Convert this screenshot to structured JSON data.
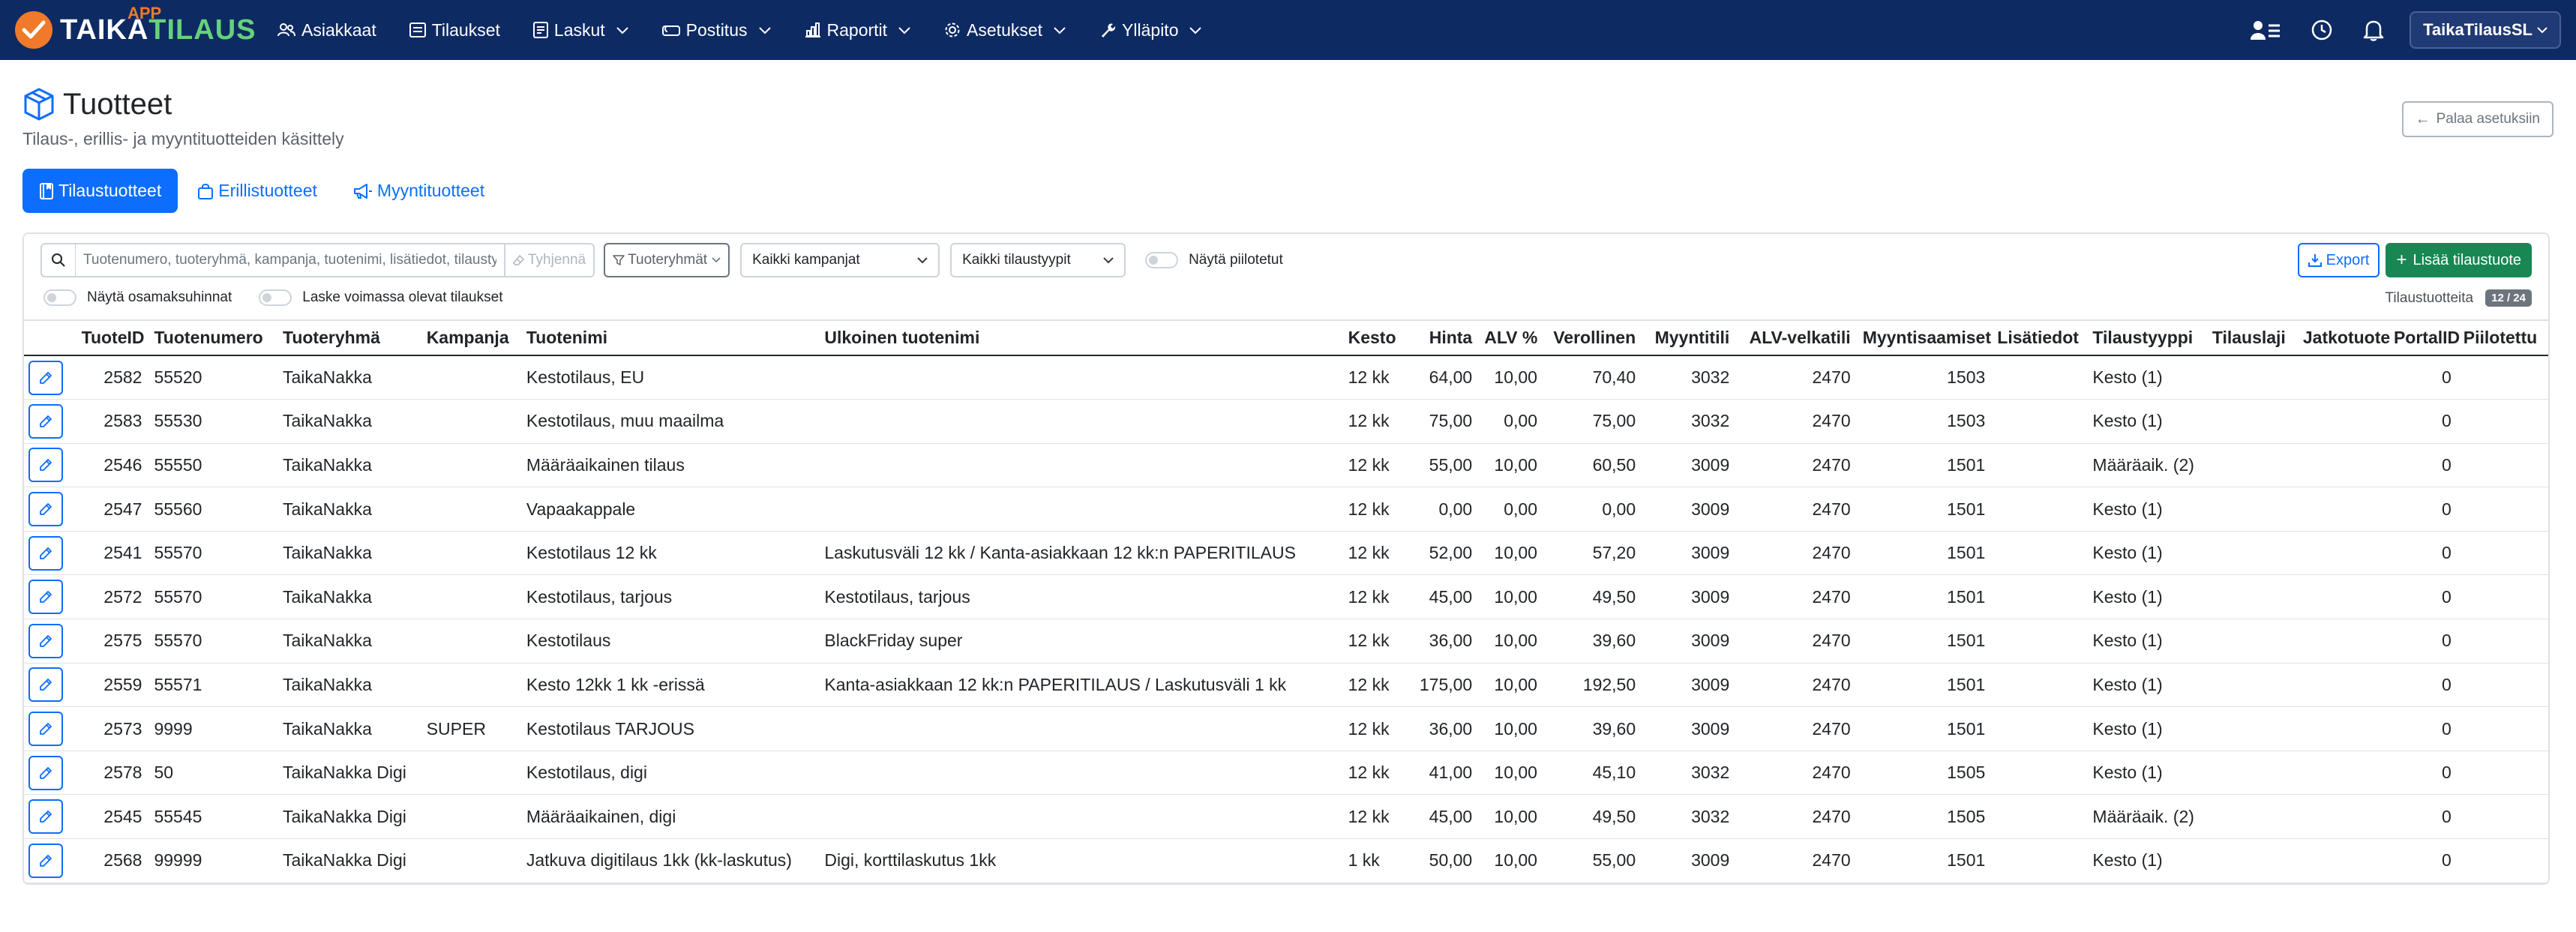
{
  "nav": {
    "brand_app": "APP",
    "brand_taika": "TAIKA",
    "brand_tilaus": "TILAUS",
    "items": [
      {
        "label": "Asiakkaat",
        "icon": "people-icon",
        "dropdown": false
      },
      {
        "label": "Tilaukset",
        "icon": "receipt-icon",
        "dropdown": false
      },
      {
        "label": "Laskut",
        "icon": "invoice-icon",
        "dropdown": true
      },
      {
        "label": "Postitus",
        "icon": "mailbox-icon",
        "dropdown": true
      },
      {
        "label": "Raportit",
        "icon": "bar-chart-icon",
        "dropdown": true
      },
      {
        "label": "Asetukset",
        "icon": "gear-icon",
        "dropdown": true
      },
      {
        "label": "Ylläpito",
        "icon": "wrench-icon",
        "dropdown": true
      }
    ],
    "user": "TaikaTilausSL"
  },
  "header": {
    "title": "Tuotteet",
    "subtitle": "Tilaus-, erillis- ja myyntituotteiden käsittely",
    "back_label": "Palaa asetuksiin"
  },
  "tabs": [
    {
      "label": "Tilaustuotteet",
      "active": true
    },
    {
      "label": "Erillistuotteet",
      "active": false
    },
    {
      "label": "Myyntituotteet",
      "active": false
    }
  ],
  "toolbar": {
    "search_placeholder": "Tuotenumero, tuoteryhmä, kampanja, tuotenimi, lisätiedot, tilaustyyppi",
    "clear_label": "Tyhjennä",
    "group_filter_label": "Tuoteryhmät",
    "campaign_select": "Kaikki kampanjat",
    "type_select": "Kaikki tilaustyypit",
    "show_hidden": "Näytä piilotetut",
    "export_label": "Export",
    "add_label": "Lisää tilaustuote",
    "show_installments": "Näytä osamaksuhinnat",
    "count_active": "Laske voimassa olevat tilaukset",
    "count_label": "Tilaustuotteita",
    "count_badge": "12 / 24"
  },
  "table": {
    "columns": [
      "TuoteID",
      "Tuotenumero",
      "Tuoteryhmä",
      "Kampanja",
      "Tuotenimi",
      "Ulkoinen tuotenimi",
      "Kesto",
      "Hinta",
      "ALV %",
      "Verollinen",
      "Myyntitili",
      "ALV-velkatili",
      "Myyntisaamiset",
      "Lisätiedot",
      "Tilaustyyppi",
      "Tilauslaji",
      "Jatkotuote",
      "PortalID",
      "Piilotettu"
    ],
    "rows": [
      [
        "2582",
        "55520",
        "TaikaNakka",
        "",
        "Kestotilaus, EU",
        "",
        "12 kk",
        "64,00",
        "10,00",
        "70,40",
        "3032",
        "2470",
        "1503",
        "",
        "Kesto (1)",
        "",
        "",
        "0",
        ""
      ],
      [
        "2583",
        "55530",
        "TaikaNakka",
        "",
        "Kestotilaus, muu maailma",
        "",
        "12 kk",
        "75,00",
        "0,00",
        "75,00",
        "3032",
        "2470",
        "1503",
        "",
        "Kesto (1)",
        "",
        "",
        "0",
        ""
      ],
      [
        "2546",
        "55550",
        "TaikaNakka",
        "",
        "Määräaikainen tilaus",
        "",
        "12 kk",
        "55,00",
        "10,00",
        "60,50",
        "3009",
        "2470",
        "1501",
        "",
        "Määräaik. (2)",
        "",
        "",
        "0",
        ""
      ],
      [
        "2547",
        "55560",
        "TaikaNakka",
        "",
        "Vapaakappale",
        "",
        "12 kk",
        "0,00",
        "0,00",
        "0,00",
        "3009",
        "2470",
        "1501",
        "",
        "Kesto (1)",
        "",
        "",
        "0",
        ""
      ],
      [
        "2541",
        "55570",
        "TaikaNakka",
        "",
        "Kestotilaus 12 kk",
        "Laskutusväli 12 kk / Kanta-asiakkaan 12 kk:n PAPERITILAUS",
        "12 kk",
        "52,00",
        "10,00",
        "57,20",
        "3009",
        "2470",
        "1501",
        "",
        "Kesto (1)",
        "",
        "",
        "0",
        ""
      ],
      [
        "2572",
        "55570",
        "TaikaNakka",
        "",
        "Kestotilaus, tarjous",
        "Kestotilaus, tarjous",
        "12 kk",
        "45,00",
        "10,00",
        "49,50",
        "3009",
        "2470",
        "1501",
        "",
        "Kesto (1)",
        "",
        "",
        "0",
        ""
      ],
      [
        "2575",
        "55570",
        "TaikaNakka",
        "",
        "Kestotilaus",
        "BlackFriday super",
        "12 kk",
        "36,00",
        "10,00",
        "39,60",
        "3009",
        "2470",
        "1501",
        "",
        "Kesto (1)",
        "",
        "",
        "0",
        ""
      ],
      [
        "2559",
        "55571",
        "TaikaNakka",
        "",
        "Kesto 12kk 1 kk -erissä",
        "Kanta-asiakkaan 12 kk:n PAPERITILAUS / Laskutusväli 1 kk",
        "12 kk",
        "175,00",
        "10,00",
        "192,50",
        "3009",
        "2470",
        "1501",
        "",
        "Kesto (1)",
        "",
        "",
        "0",
        ""
      ],
      [
        "2573",
        "9999",
        "TaikaNakka",
        "SUPER",
        "Kestotilaus TARJOUS",
        "",
        "12 kk",
        "36,00",
        "10,00",
        "39,60",
        "3009",
        "2470",
        "1501",
        "",
        "Kesto (1)",
        "",
        "",
        "0",
        ""
      ],
      [
        "2578",
        "50",
        "TaikaNakka Digi",
        "",
        "Kestotilaus, digi",
        "",
        "12 kk",
        "41,00",
        "10,00",
        "45,10",
        "3032",
        "2470",
        "1505",
        "",
        "Kesto (1)",
        "",
        "",
        "0",
        ""
      ],
      [
        "2545",
        "55545",
        "TaikaNakka Digi",
        "",
        "Määräaikainen, digi",
        "",
        "12 kk",
        "45,00",
        "10,00",
        "49,50",
        "3032",
        "2470",
        "1505",
        "",
        "Määräaik. (2)",
        "",
        "",
        "0",
        ""
      ],
      [
        "2568",
        "99999",
        "TaikaNakka Digi",
        "",
        "Jatkuva digitilaus 1kk (kk-laskutus)",
        "Digi, korttilaskutus 1kk",
        "1 kk",
        "50,00",
        "10,00",
        "55,00",
        "3009",
        "2470",
        "1501",
        "",
        "Kesto (1)",
        "",
        "",
        "0",
        ""
      ]
    ]
  },
  "colors": {
    "navbar": "#0e2a63",
    "primary": "#0d6efd",
    "success": "#198754",
    "brand_orange": "#f07a2a",
    "brand_green": "#66d17a"
  }
}
